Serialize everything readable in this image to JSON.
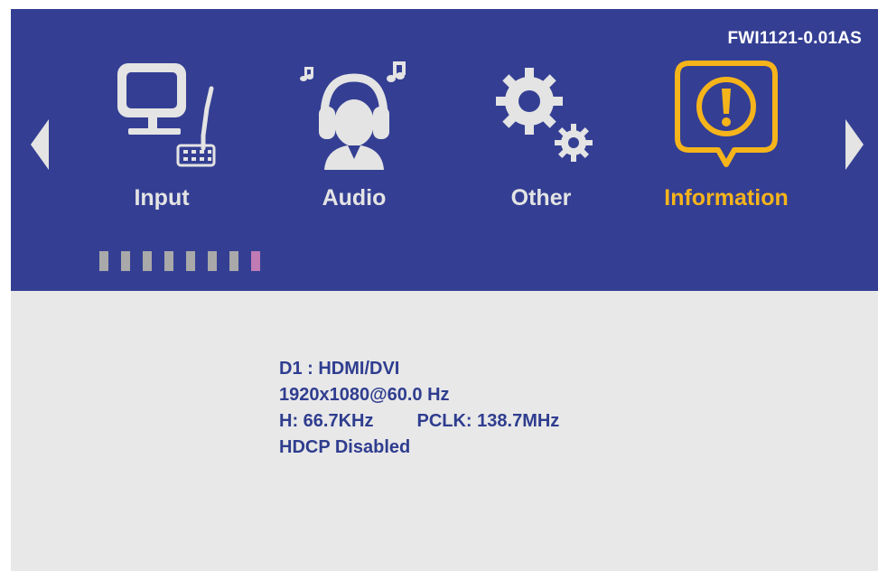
{
  "model_id": "FWI1121-0.01AS",
  "menu": [
    {
      "label": "Input",
      "icon": "monitor-icon",
      "selected": false
    },
    {
      "label": "Audio",
      "icon": "headphones-icon",
      "selected": false
    },
    {
      "label": "Other",
      "icon": "gears-icon",
      "selected": false
    },
    {
      "label": "Information",
      "icon": "info-bubble-icon",
      "selected": true
    }
  ],
  "page_indicator": {
    "total": 8,
    "active_index": 7
  },
  "info": {
    "line1": "D1 : HDMI/DVI",
    "line2": "1920x1080@60.0 Hz",
    "h_freq": "H: 66.7KHz",
    "pclk": "PCLK: 138.7MHz",
    "hdcp": "HDCP Disabled"
  },
  "colors": {
    "header_bg": "#343f93",
    "content_bg": "#e8e8e8",
    "icon_gray": "#e4e4e4",
    "accent": "#f6b41b",
    "info_text": "#2f3d8f",
    "indicator_gray": "#a9a9a9",
    "indicator_active": "#c07ab4"
  }
}
